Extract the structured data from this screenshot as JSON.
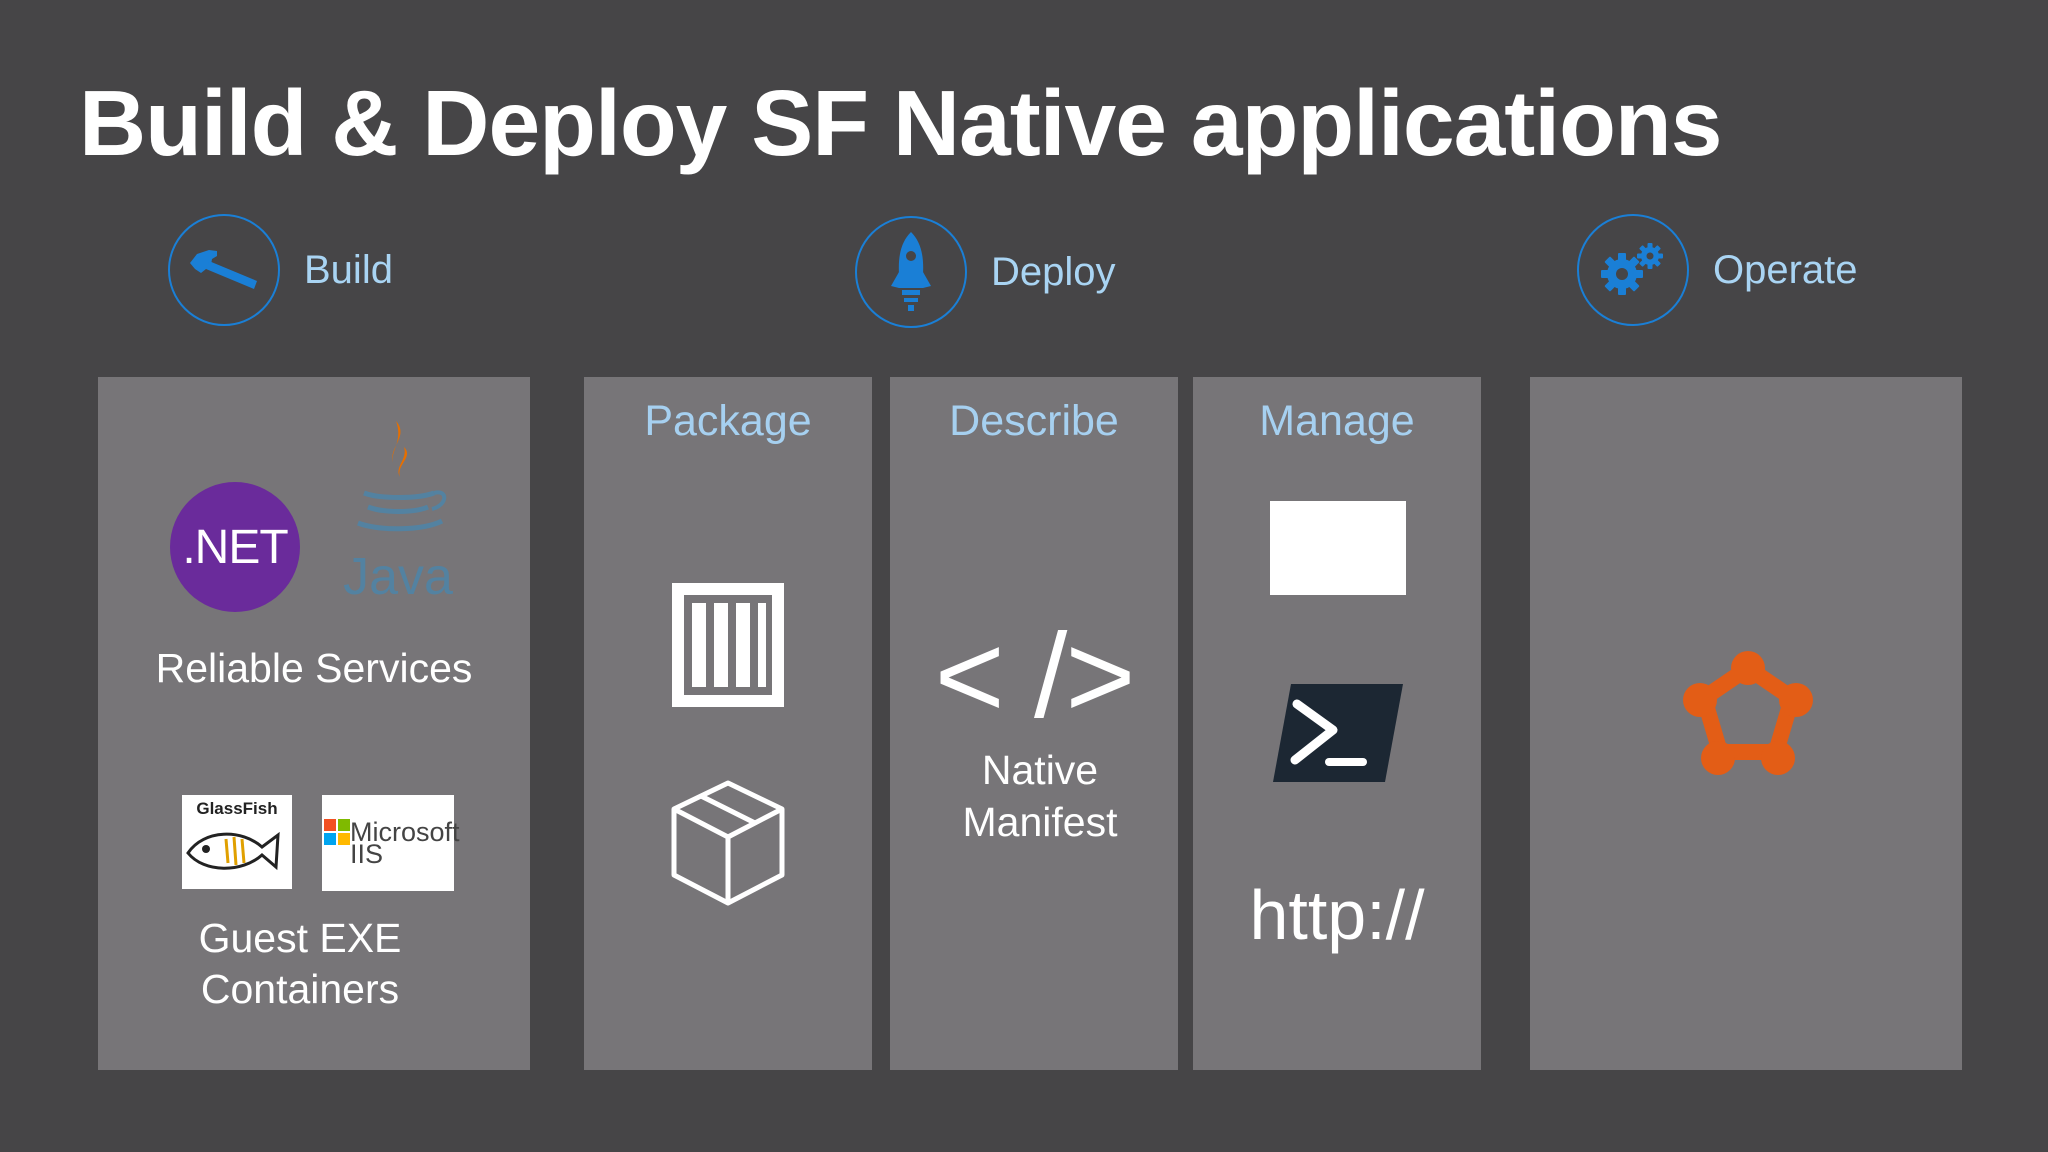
{
  "title": "Build & Deploy SF Native applications",
  "phases": {
    "build": "Build",
    "deploy": "Deploy",
    "operate": "Operate"
  },
  "build_panel": {
    "net_logo_text": ".NET",
    "java_logo_text": "Java",
    "reliable_services": "Reliable Services",
    "glassfish_logo_text": "GlassFish",
    "iis_logo_text_line1": "Microsoft",
    "iis_logo_text_line2": "IIS",
    "guest_exe": "Guest EXE",
    "containers": "Containers"
  },
  "columns": {
    "package": "Package",
    "describe": "Describe",
    "manage": "Manage"
  },
  "describe_panel": {
    "code_glyph": "< />",
    "native": "Native",
    "manifest": "Manifest"
  },
  "manage_panel": {
    "http": "http://"
  },
  "colors": {
    "background": "#464547",
    "panel": "#777578",
    "accent_blue": "#1a7fd6",
    "label_blue": "#a9d4f3",
    "net_purple": "#6a2b9b",
    "java_orange": "#e76f00",
    "java_blue": "#5382a1",
    "service_fabric_orange": "#e35d16",
    "powershell_bg": "#1c2733"
  },
  "icons": [
    "hammer-icon",
    "rocket-icon",
    "gears-icon",
    "container-icon",
    "package-box-icon",
    "window-icon",
    "powershell-icon",
    "service-fabric-icon"
  ]
}
